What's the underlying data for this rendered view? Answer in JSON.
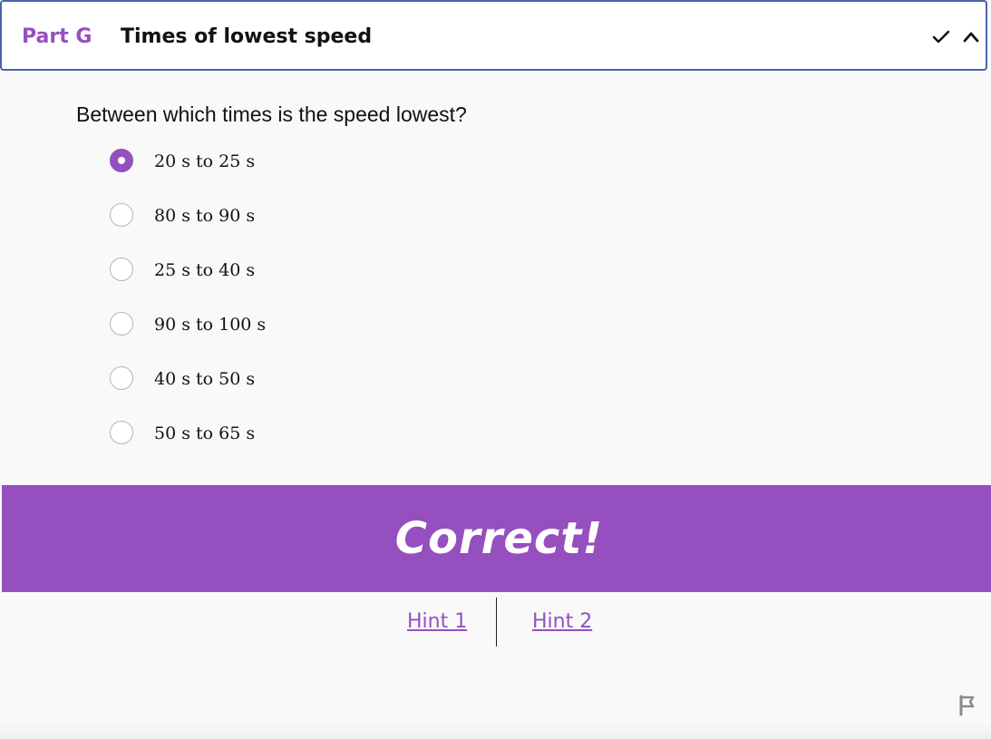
{
  "header": {
    "part_label": "Part G",
    "title": "Times of lowest speed",
    "check_icon": "checkmark-icon",
    "collapse_icon": "chevron-up-icon"
  },
  "question": {
    "text": "Between which times is the speed lowest?",
    "options": [
      {
        "label": "20 s to 25 s",
        "selected": true
      },
      {
        "label": "80 s to 90 s",
        "selected": false
      },
      {
        "label": "25 s to 40 s",
        "selected": false
      },
      {
        "label": "90 s to 100 s",
        "selected": false
      },
      {
        "label": "40 s to 50 s",
        "selected": false
      },
      {
        "label": "50 s to 65 s",
        "selected": false
      }
    ]
  },
  "feedback": {
    "text": "Correct!"
  },
  "hints": [
    {
      "label": "Hint 1"
    },
    {
      "label": "Hint 2"
    }
  ],
  "colors": {
    "accent": "#9650be",
    "header_border": "#4a64aa",
    "background": "#f9f9f9"
  },
  "footer": {
    "flag_icon": "flag-icon"
  }
}
